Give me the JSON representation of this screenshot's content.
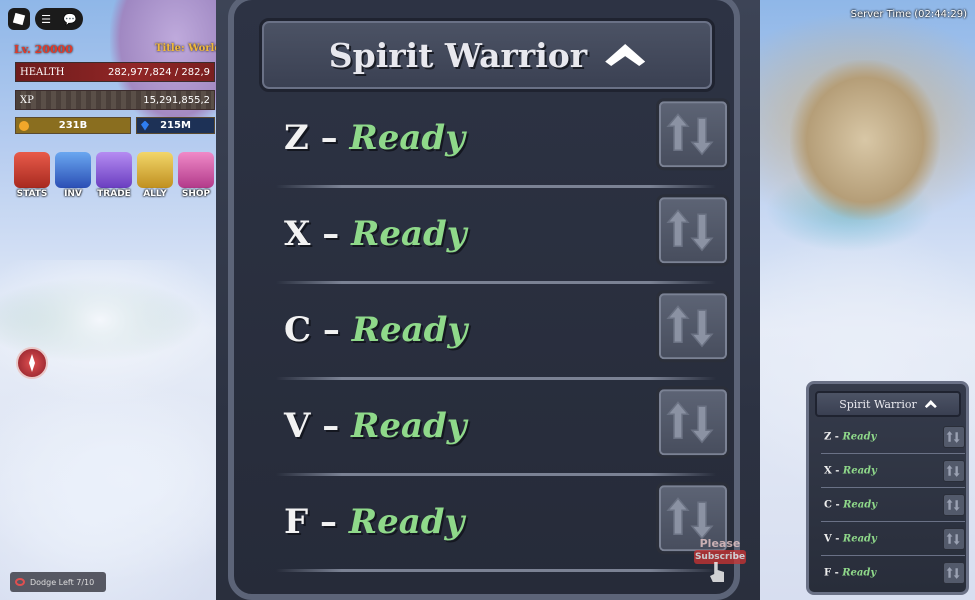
{
  "hud": {
    "level": "Lv. 20000",
    "title": "Title: World B",
    "health_label": "HEALTH",
    "health_value": "282,977,824 / 282,9",
    "xp_label": "XP",
    "xp_value": "15,291,855,2",
    "gold": "231B",
    "gems": "215M",
    "buttons": [
      {
        "label": "STATS",
        "icon": "stats-icon"
      },
      {
        "label": "INV",
        "icon": "inventory-icon"
      },
      {
        "label": "TRADE",
        "icon": "trade-icon"
      },
      {
        "label": "ALLY",
        "icon": "ally-icon"
      },
      {
        "label": "SHOP",
        "icon": "shop-icon"
      }
    ],
    "dodge": "Dodge Left 7/10"
  },
  "server_time": "Server Time (02:44:29)",
  "skill_panel": {
    "title": "Spirit Warrior",
    "skills": [
      {
        "key": "Z",
        "status": "Ready"
      },
      {
        "key": "X",
        "status": "Ready"
      },
      {
        "key": "C",
        "status": "Ready"
      },
      {
        "key": "V",
        "status": "Ready"
      },
      {
        "key": "F",
        "status": "Ready"
      }
    ]
  },
  "mini_panel": {
    "title": "Spirit Warrior",
    "skills": [
      {
        "key": "Z",
        "status": "Ready"
      },
      {
        "key": "X",
        "status": "Ready"
      },
      {
        "key": "C",
        "status": "Ready"
      },
      {
        "key": "V",
        "status": "Ready"
      },
      {
        "key": "F",
        "status": "Ready"
      }
    ]
  },
  "overlay": {
    "line1": "Please",
    "line2": "Subscribe"
  },
  "colors": {
    "ready": "#8fd98a",
    "panel": "#2c3242",
    "health": "#912626",
    "level": "#e23a2a"
  }
}
